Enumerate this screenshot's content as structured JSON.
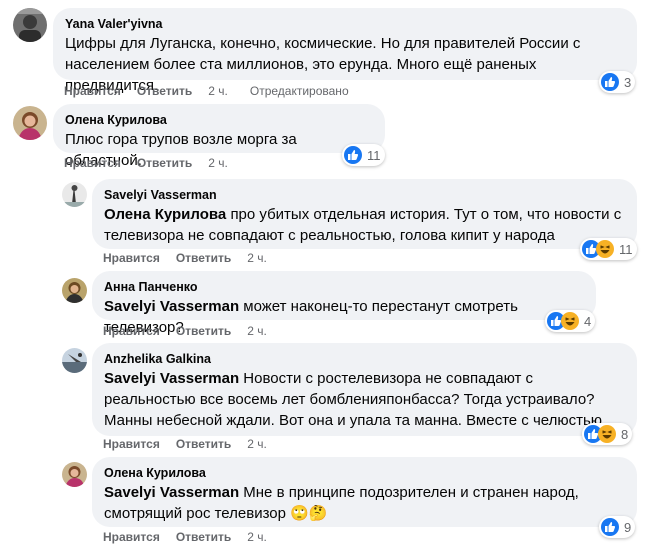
{
  "actions": {
    "like_label": "Нравится",
    "reply_label": "Ответить"
  },
  "comments": [
    {
      "author": "Yana Valer'yivna",
      "text": "Цифры для Луганска, конечно, космические. Но для правителей России с населением более ста миллионов, это ерунда. Много ещё раненых предвидится.",
      "time": "2 ч.",
      "edited": "Отредактировано",
      "reactions": {
        "count": "3",
        "icons": [
          "like-icon"
        ]
      }
    },
    {
      "author": "Олена Курилова",
      "text": "Плюс гора трупов возле морга за областной.",
      "time": "2 ч.",
      "reactions": {
        "count": "11",
        "icons": [
          "like-icon"
        ]
      }
    },
    {
      "author": "Savelyi Vasserman",
      "mention": "Олена Курилова",
      "text": "про убитых отдельная история. Тут о том, что новости с телевизора не совпадают с реальностью, голова кипит у народа",
      "time": "2 ч.",
      "reactions": {
        "count": "11",
        "icons": [
          "like-icon",
          "haha-icon"
        ]
      }
    },
    {
      "author": "Анна Панченко",
      "mention": "Savelyi Vasserman",
      "text": "может наконец-то перестанут смотреть телевизор?",
      "time": "2 ч.",
      "reactions": {
        "count": "4",
        "icons": [
          "like-icon",
          "haha-icon"
        ]
      }
    },
    {
      "author": "Anzhelika Galkina",
      "mention": "Savelyi Vasserman",
      "text": "Новости с ростелевизора не совпадают с реальностью все восемь лет бомбленияпонбасса? Тогда устраивало? Манны небесной ждали. Вот она и упала та манна. Вместе с челюстью.",
      "time": "2 ч.",
      "reactions": {
        "count": "8",
        "icons": [
          "like-icon",
          "haha-icon"
        ]
      }
    },
    {
      "author": "Олена Курилова",
      "mention": "Savelyi Vasserman",
      "text": "Мне в принципе подозрителен и странен народ, смотрящий рос телевизор",
      "time": "2 ч.",
      "emoji": [
        "🙄",
        "🤔"
      ],
      "reactions": {
        "count": "9",
        "icons": [
          "like-icon"
        ]
      }
    }
  ],
  "colors": {
    "bubble": "#f0f2f5",
    "meta": "#65676b",
    "like": "#1877f2",
    "haha": "#f7b125"
  }
}
